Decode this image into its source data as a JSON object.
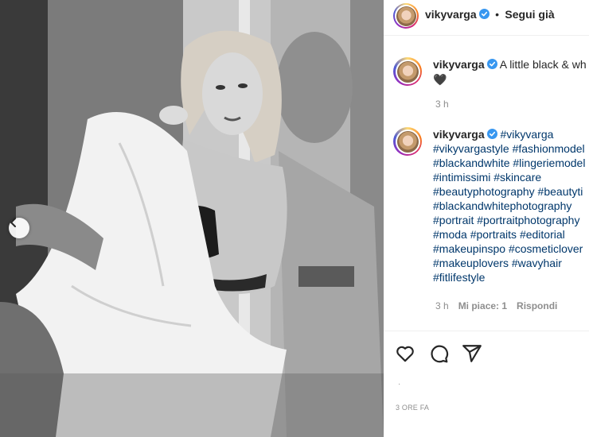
{
  "post": {
    "author": "vikyvarga",
    "follow_separator": "•",
    "follow_label": "Segui già",
    "caption": {
      "author": "vikyvarga",
      "text": "A little black & wh",
      "emoji": "🖤",
      "time": "3 h"
    },
    "comment": {
      "author": "vikyvarga",
      "lines": [
        "#vikyvarga",
        "#vikyvargastyle #fashionmodel",
        "#blackandwhite #lingeriemodel",
        "#intimissimi #skincare",
        "#beautyphotography #beautyti",
        "#blackandwhitephotography",
        "#portrait #portraitphotography",
        "#moda #portraits #editorial",
        "#makeupinspo #cosmeticlover",
        "#makeuplovers #wavyhair",
        "#fitlifestyle"
      ],
      "time": "3 h",
      "likes": "Mi piace: 1",
      "reply": "Rispondi"
    },
    "likes_small": "·",
    "timestamp": "3 ORE FA"
  },
  "icons": {
    "verified_color": "#3897f0",
    "link_color": "#00376b"
  }
}
